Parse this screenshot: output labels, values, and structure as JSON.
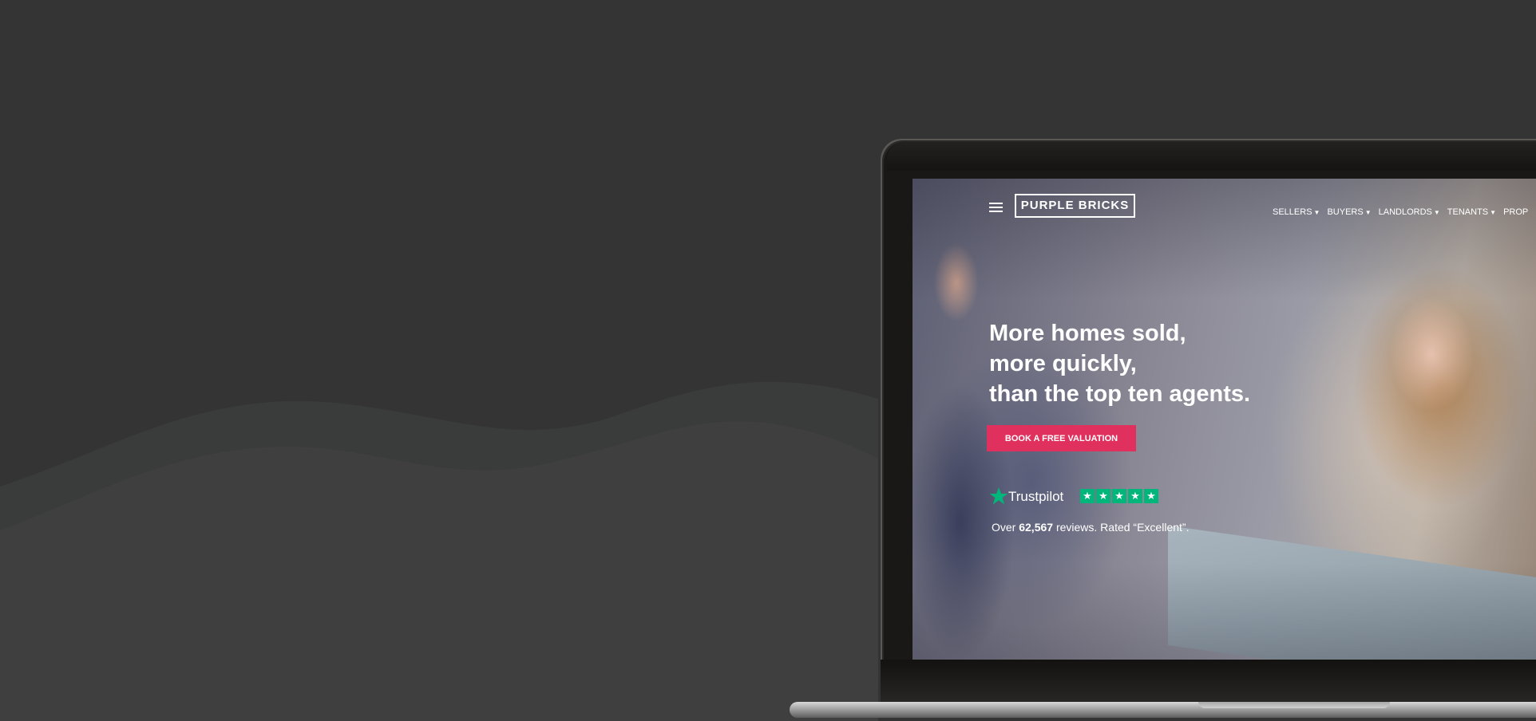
{
  "colors": {
    "background": "#343434",
    "accent": "#e0305e",
    "trustpilot_green": "#00b67a"
  },
  "site": {
    "logo_text": "PURPLE BRICKS",
    "menu_icon": "hamburger-icon",
    "nav": [
      "SELLERS",
      "BUYERS",
      "LANDLORDS",
      "TENANTS",
      "PROP"
    ]
  },
  "hero": {
    "headline_lines": [
      "More homes sold,",
      "more quickly,",
      "than the top ten agents."
    ],
    "cta_label": "BOOK A FREE VALUATION"
  },
  "trustpilot": {
    "brand": "Trustpilot",
    "star_icon": "trustpilot-star-icon",
    "rating_stars": 5,
    "reviews_prefix": "Over ",
    "reviews_count": "62,567",
    "reviews_suffix": " reviews. Rated “Excellent”."
  }
}
